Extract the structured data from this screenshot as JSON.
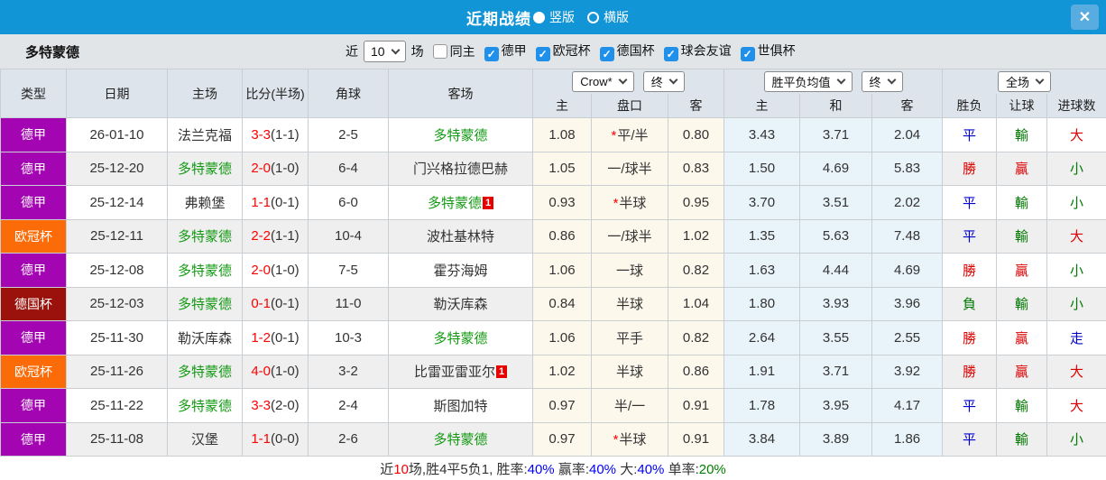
{
  "titlebar": {
    "title": "近期战绩",
    "layout_options": [
      {
        "label": "竖版",
        "selected": true
      },
      {
        "label": "横版",
        "selected": false
      }
    ],
    "close_icon": "✕"
  },
  "filterbar": {
    "team": "多特蒙德",
    "recent_prefix": "近",
    "recent_value": "10",
    "recent_suffix": "场",
    "same_home": {
      "label": "同主",
      "checked": false
    },
    "competitions": [
      {
        "label": "德甲",
        "checked": true
      },
      {
        "label": "欧冠杯",
        "checked": true
      },
      {
        "label": "德国杯",
        "checked": true
      },
      {
        "label": "球会友谊",
        "checked": true
      },
      {
        "label": "世俱杯",
        "checked": true
      }
    ],
    "check_glyph": "✓"
  },
  "table": {
    "dropdowns": {
      "bookmaker": "Crow*",
      "bookmaker_time": "终",
      "europe": "胜平负均值",
      "europe_time": "终",
      "scope": "全场"
    },
    "columns": [
      "类型",
      "日期",
      "主场",
      "比分(半场)",
      "角球",
      "客场",
      "主",
      "盘口",
      "客",
      "主",
      "和",
      "客",
      "胜负",
      "让球",
      "进球数"
    ],
    "rows": [
      {
        "league": "德甲",
        "date": "26-01-10",
        "home": "法兰克福",
        "home_green": false,
        "score": "3-3",
        "half": "(1-1)",
        "corner": "2-5",
        "away": "多特蒙德",
        "away_green": true,
        "away_badge": "",
        "asia_home": "1.08",
        "handicap": "平/半",
        "handicap_star": true,
        "asia_away": "0.80",
        "euro_home": "3.43",
        "euro_draw": "3.71",
        "euro_away": "2.04",
        "r_wdl": "平",
        "r_handicap": "輸",
        "r_goals": "大"
      },
      {
        "league": "德甲",
        "date": "25-12-20",
        "home": "多特蒙德",
        "home_green": true,
        "score": "2-0",
        "half": "(1-0)",
        "corner": "6-4",
        "away": "门兴格拉德巴赫",
        "away_green": false,
        "away_badge": "",
        "asia_home": "1.05",
        "handicap": "一/球半",
        "handicap_star": false,
        "asia_away": "0.83",
        "euro_home": "1.50",
        "euro_draw": "4.69",
        "euro_away": "5.83",
        "r_wdl": "勝",
        "r_handicap": "贏",
        "r_goals": "小"
      },
      {
        "league": "德甲",
        "date": "25-12-14",
        "home": "弗赖堡",
        "home_green": false,
        "score": "1-1",
        "half": "(0-1)",
        "corner": "6-0",
        "away": "多特蒙德",
        "away_green": true,
        "away_badge": "1",
        "asia_home": "0.93",
        "handicap": "半球",
        "handicap_star": true,
        "asia_away": "0.95",
        "euro_home": "3.70",
        "euro_draw": "3.51",
        "euro_away": "2.02",
        "r_wdl": "平",
        "r_handicap": "輸",
        "r_goals": "小"
      },
      {
        "league": "欧冠杯",
        "date": "25-12-11",
        "home": "多特蒙德",
        "home_green": true,
        "score": "2-2",
        "half": "(1-1)",
        "corner": "10-4",
        "away": "波杜基林特",
        "away_green": false,
        "away_badge": "",
        "asia_home": "0.86",
        "handicap": "一/球半",
        "handicap_star": false,
        "asia_away": "1.02",
        "euro_home": "1.35",
        "euro_draw": "5.63",
        "euro_away": "7.48",
        "r_wdl": "平",
        "r_handicap": "輸",
        "r_goals": "大"
      },
      {
        "league": "德甲",
        "date": "25-12-08",
        "home": "多特蒙德",
        "home_green": true,
        "score": "2-0",
        "half": "(1-0)",
        "corner": "7-5",
        "away": "霍芬海姆",
        "away_green": false,
        "away_badge": "",
        "asia_home": "1.06",
        "handicap": "一球",
        "handicap_star": false,
        "asia_away": "0.82",
        "euro_home": "1.63",
        "euro_draw": "4.44",
        "euro_away": "4.69",
        "r_wdl": "勝",
        "r_handicap": "贏",
        "r_goals": "小"
      },
      {
        "league": "德国杯",
        "date": "25-12-03",
        "home": "多特蒙德",
        "home_green": true,
        "score": "0-1",
        "half": "(0-1)",
        "corner": "11-0",
        "away": "勒沃库森",
        "away_green": false,
        "away_badge": "",
        "asia_home": "0.84",
        "handicap": "半球",
        "handicap_star": false,
        "asia_away": "1.04",
        "euro_home": "1.80",
        "euro_draw": "3.93",
        "euro_away": "3.96",
        "r_wdl": "負",
        "r_handicap": "輸",
        "r_goals": "小"
      },
      {
        "league": "德甲",
        "date": "25-11-30",
        "home": "勒沃库森",
        "home_green": false,
        "score": "1-2",
        "half": "(0-1)",
        "corner": "10-3",
        "away": "多特蒙德",
        "away_green": true,
        "away_badge": "",
        "asia_home": "1.06",
        "handicap": "平手",
        "handicap_star": false,
        "asia_away": "0.82",
        "euro_home": "2.64",
        "euro_draw": "3.55",
        "euro_away": "2.55",
        "r_wdl": "勝",
        "r_handicap": "贏",
        "r_goals": "走"
      },
      {
        "league": "欧冠杯",
        "date": "25-11-26",
        "home": "多特蒙德",
        "home_green": true,
        "score": "4-0",
        "half": "(1-0)",
        "corner": "3-2",
        "away": "比雷亚雷亚尔",
        "away_green": false,
        "away_badge": "1",
        "asia_home": "1.02",
        "handicap": "半球",
        "handicap_star": false,
        "asia_away": "0.86",
        "euro_home": "1.91",
        "euro_draw": "3.71",
        "euro_away": "3.92",
        "r_wdl": "勝",
        "r_handicap": "贏",
        "r_goals": "大"
      },
      {
        "league": "德甲",
        "date": "25-11-22",
        "home": "多特蒙德",
        "home_green": true,
        "score": "3-3",
        "half": "(2-0)",
        "corner": "2-4",
        "away": "斯图加特",
        "away_green": false,
        "away_badge": "",
        "asia_home": "0.97",
        "handicap": "半/一",
        "handicap_star": false,
        "asia_away": "0.91",
        "euro_home": "1.78",
        "euro_draw": "3.95",
        "euro_away": "4.17",
        "r_wdl": "平",
        "r_handicap": "輸",
        "r_goals": "大"
      },
      {
        "league": "德甲",
        "date": "25-11-08",
        "home": "汉堡",
        "home_green": false,
        "score": "1-1",
        "half": "(0-0)",
        "corner": "2-6",
        "away": "多特蒙德",
        "away_green": true,
        "away_badge": "",
        "asia_home": "0.97",
        "handicap": "半球",
        "handicap_star": true,
        "asia_away": "0.91",
        "euro_home": "3.84",
        "euro_draw": "3.89",
        "euro_away": "1.86",
        "r_wdl": "平",
        "r_handicap": "輸",
        "r_goals": "小"
      }
    ]
  },
  "footer": {
    "segments": [
      {
        "text": "近",
        "color": "#333333"
      },
      {
        "text": "10",
        "color": "#ff0000"
      },
      {
        "text": "场,胜4平5负1, 胜率:",
        "color": "#333333"
      },
      {
        "text": "40%",
        "color": "#0000ff"
      },
      {
        "text": " 赢率:",
        "color": "#333333"
      },
      {
        "text": "40%",
        "color": "#0000ff"
      },
      {
        "text": " 大:",
        "color": "#333333"
      },
      {
        "text": "40%",
        "color": "#0000ff"
      },
      {
        "text": " 单率:",
        "color": "#333333"
      },
      {
        "text": "20%",
        "color": "#008000"
      }
    ]
  },
  "colors": {
    "league": {
      "德甲": "#a305b2",
      "欧冠杯": "#fb6c09",
      "德国杯": "#9b120d"
    },
    "result_map": {
      "勝": "res-red",
      "贏": "res-red",
      "大": "res-red",
      "平": "res-blue",
      "走": "res-blue",
      "輸": "res-green",
      "負": "res-green",
      "小": "res-green"
    },
    "team_green": "#149a14",
    "topbar_blue": "#1295d6"
  }
}
